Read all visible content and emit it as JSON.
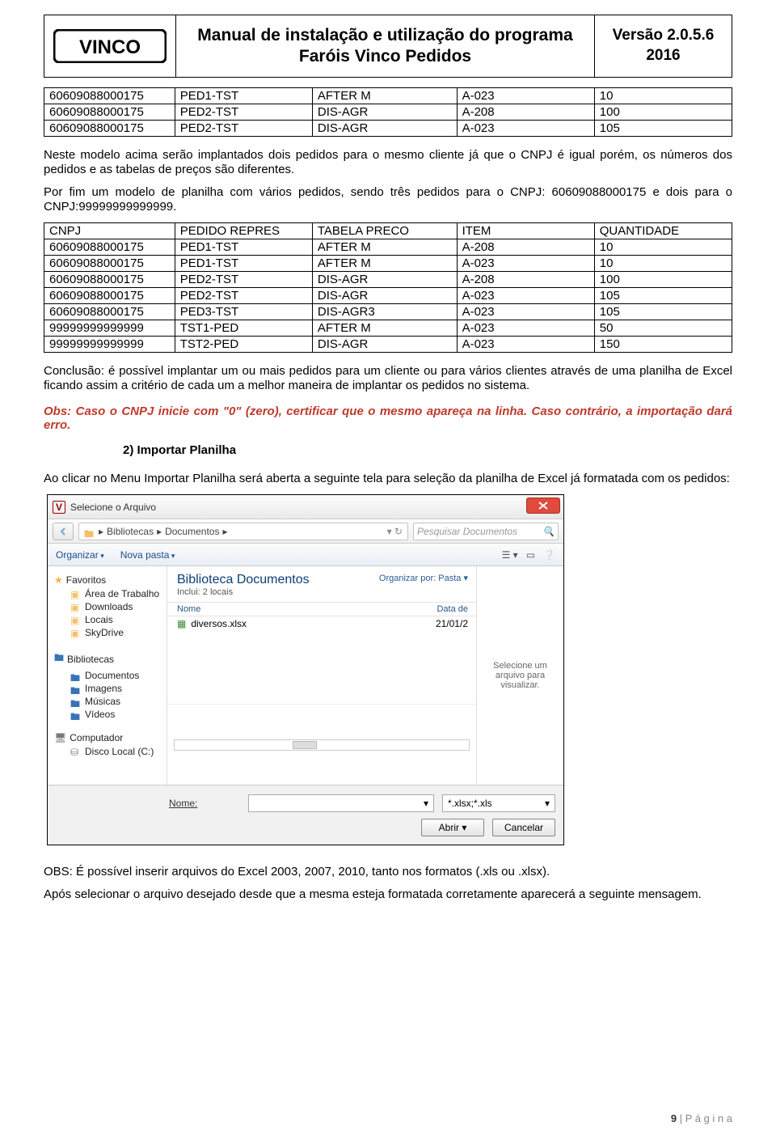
{
  "header": {
    "title": "Manual de instalação e utilização do programa Faróis Vinco Pedidos",
    "version_line1": "Versão 2.0.5.6",
    "version_line2": "2016",
    "logo_text": "VINCO"
  },
  "table1": {
    "rows": [
      [
        "60609088000175",
        "PED1-TST",
        "AFTER M",
        "A-023",
        "10"
      ],
      [
        "60609088000175",
        "PED2-TST",
        "DIS-AGR",
        "A-208",
        "100"
      ],
      [
        "60609088000175",
        "PED2-TST",
        "DIS-AGR",
        "A-023",
        "105"
      ]
    ]
  },
  "para1": "Neste modelo acima serão implantados dois pedidos para o mesmo cliente já que o CNPJ é igual porém, os números dos pedidos e as tabelas de preços são diferentes.",
  "para2": "Por fim um modelo de planilha com vários pedidos, sendo três pedidos para o CNPJ: 60609088000175 e dois para o CNPJ:99999999999999.",
  "table2": {
    "header": [
      "CNPJ",
      "PEDIDO REPRES",
      "TABELA PRECO",
      "ITEM",
      "QUANTIDADE"
    ],
    "rows": [
      [
        "60609088000175",
        "PED1-TST",
        "AFTER M",
        "A-208",
        "10"
      ],
      [
        "60609088000175",
        "PED1-TST",
        "AFTER M",
        "A-023",
        "10"
      ],
      [
        "60609088000175",
        "PED2-TST",
        "DIS-AGR",
        "A-208",
        "100"
      ],
      [
        "60609088000175",
        "PED2-TST",
        "DIS-AGR",
        "A-023",
        "105"
      ],
      [
        "60609088000175",
        "PED3-TST",
        "DIS-AGR3",
        "A-023",
        "105"
      ],
      [
        "99999999999999",
        "TST1-PED",
        "AFTER M",
        "A-023",
        "50"
      ],
      [
        "99999999999999",
        "TST2-PED",
        "DIS-AGR",
        "A-023",
        "150"
      ]
    ]
  },
  "para3": "Conclusão: é possível implantar um ou mais pedidos para um cliente ou para vários clientes através de uma planilha de Excel ficando assim a critério de cada um a melhor maneira de implantar os pedidos no sistema.",
  "red_note": "Obs: Caso o CNPJ inicie com \"0\" (zero), certificar que o mesmo apareça na linha. Caso contrário, a importação dará erro.",
  "subhead": "2)  Importar Planilha",
  "para4": "Ao clicar no Menu Importar Planilha será aberta a seguinte tela para seleção da planilha de Excel já formatada com os pedidos:",
  "dialog": {
    "title": "Selecione o Arquivo",
    "breadcrumb_root": "Bibliotecas",
    "breadcrumb_leaf": "Documentos",
    "search_placeholder": "Pesquisar Documentos",
    "organize": "Organizar",
    "new_folder": "Nova pasta",
    "nav": {
      "favorites": "Favoritos",
      "fav_items": [
        "Área de Trabalho",
        "Downloads",
        "Locais",
        "SkyDrive"
      ],
      "libraries": "Bibliotecas",
      "lib_items": [
        "Documentos",
        "Imagens",
        "Músicas",
        "Vídeos"
      ],
      "computer": "Computador",
      "comp_items": [
        "Disco Local (C:)"
      ]
    },
    "lib_title": "Biblioteca Documentos",
    "lib_sub": "Inclui: 2 locais",
    "org_by_label": "Organizar por:",
    "org_by_value": "Pasta",
    "col_name": "Nome",
    "col_date": "Data de",
    "file_name": "diversos.xlsx",
    "file_date": "21/01/2",
    "preview_text": "Selecione um arquivo para visualizar.",
    "name_label": "Nome:",
    "filter": "*.xlsx;*.xls",
    "open_btn": "Abrir",
    "cancel_btn": "Cancelar"
  },
  "para5": "OBS: É possível inserir arquivos do Excel 2003, 2007, 2010, tanto nos formatos (.xls ou .xlsx).",
  "para6": "Após selecionar o arquivo desejado desde que a mesma esteja formatada corretamente aparecerá a seguinte mensagem.",
  "footer_num": "9",
  "footer_lbl": " | P á g i n a"
}
